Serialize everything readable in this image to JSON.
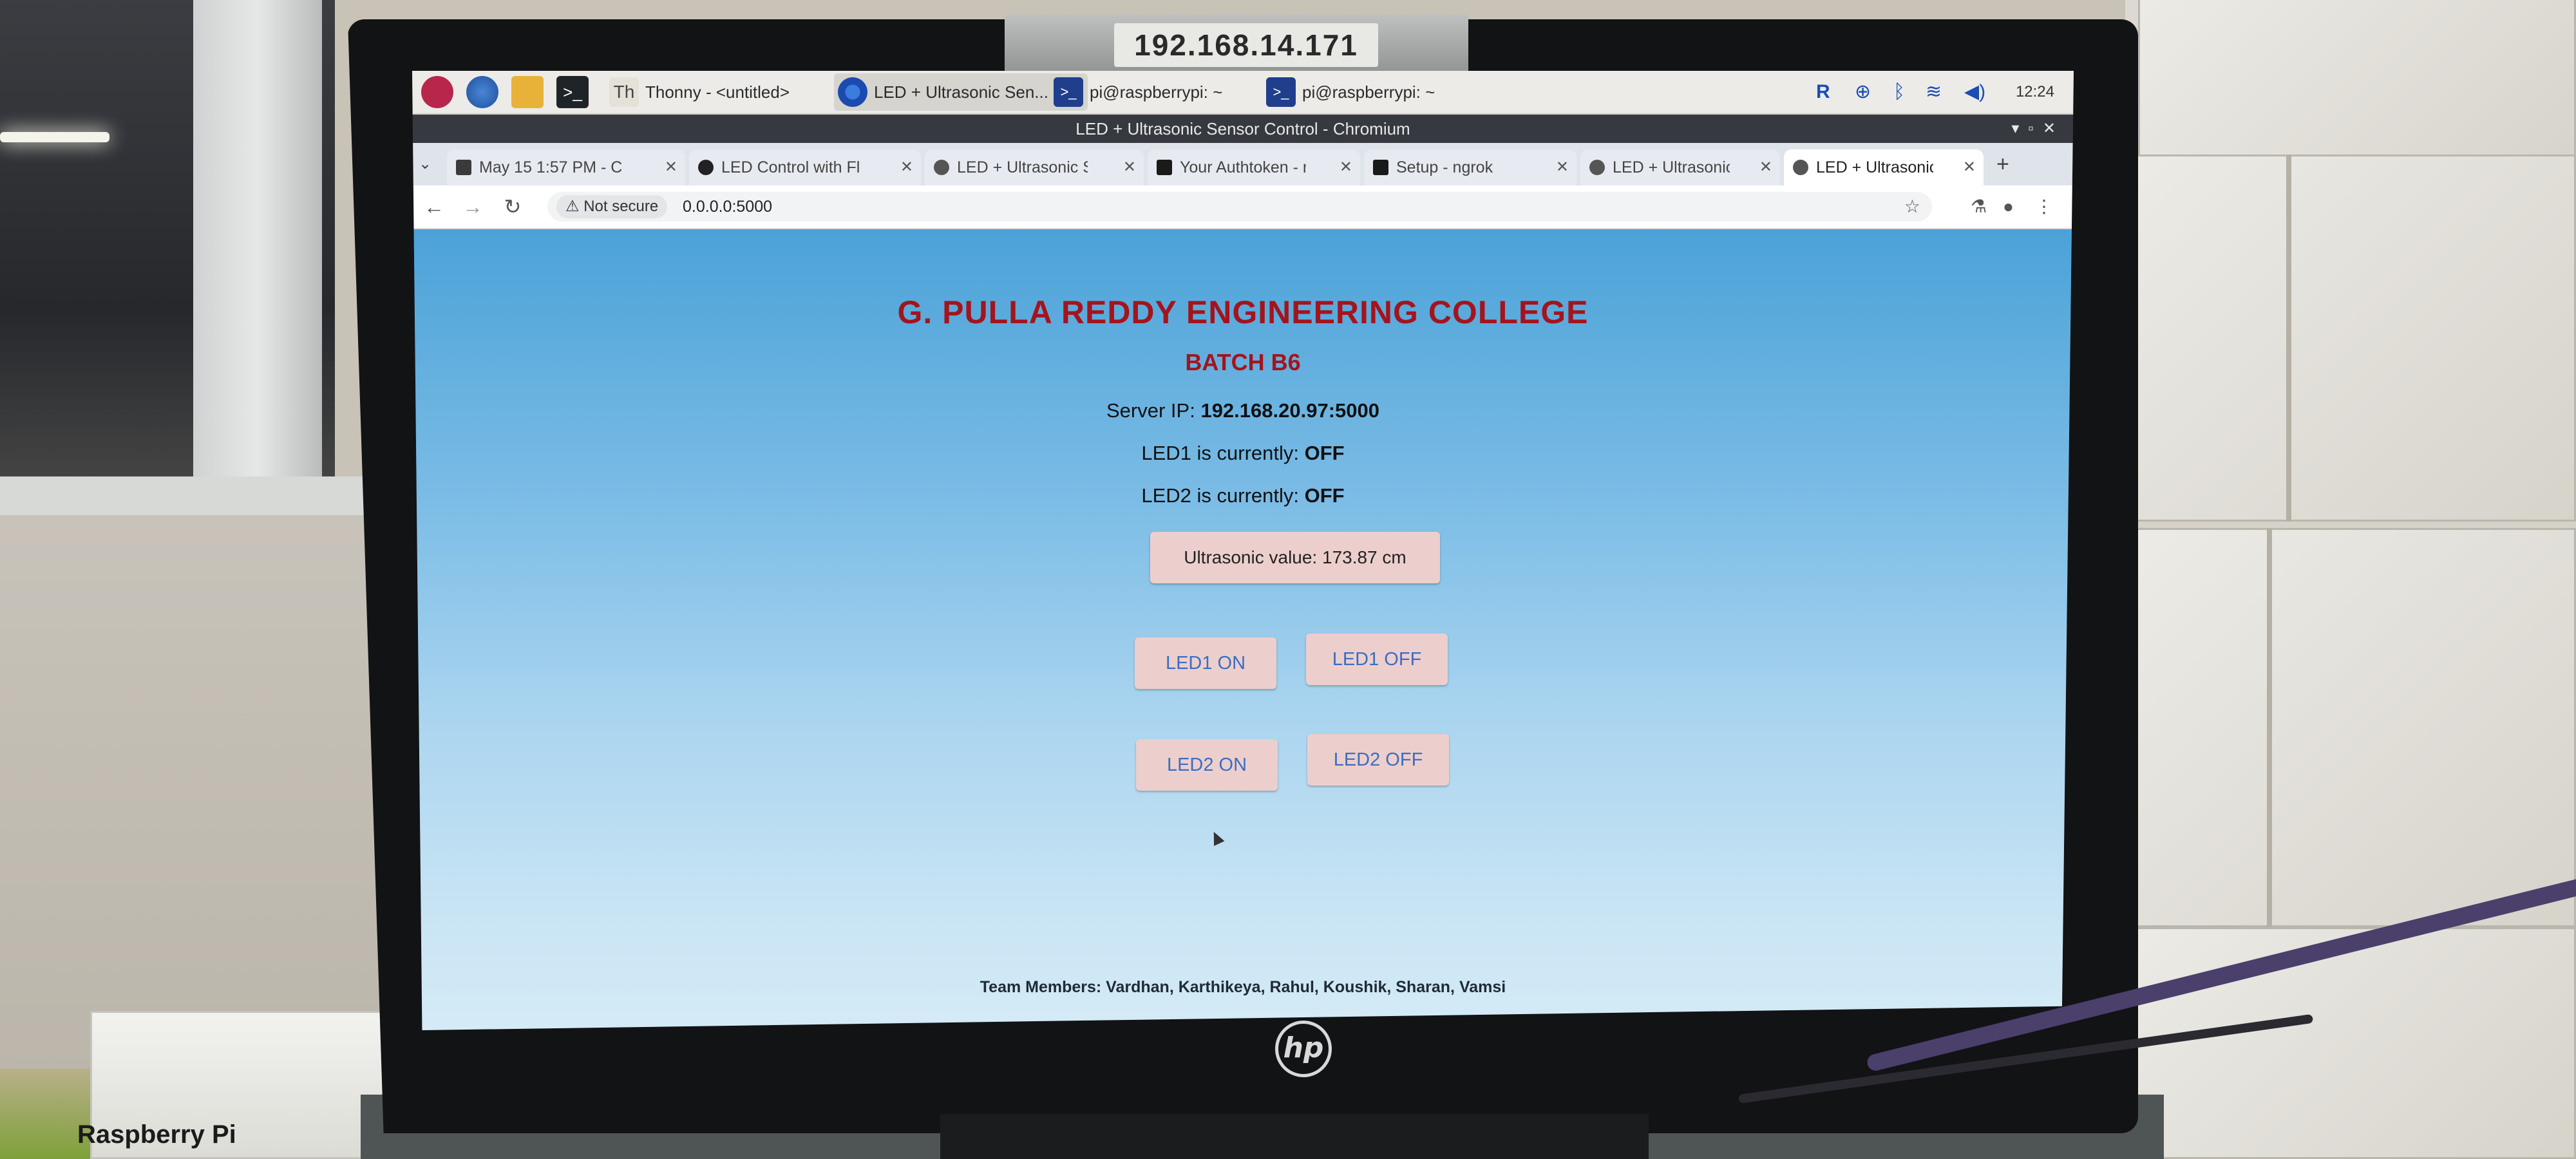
{
  "monitor": {
    "ip_sticker": "192.168.14.171",
    "brand": "hp"
  },
  "room": {
    "box_label": "Raspberry Pi"
  },
  "taskbar": {
    "tasks": [
      {
        "label": "Thonny - <untitled>",
        "icon": "thonny-icon"
      },
      {
        "label": "LED + Ultrasonic Sen...",
        "icon": "chromium-icon"
      },
      {
        "label": "pi@raspberrypi: ~",
        "icon": "terminal-icon"
      },
      {
        "label": "pi@raspberrypi: ~",
        "icon": "terminal-icon"
      }
    ],
    "clock": "12:24"
  },
  "window": {
    "title": "LED + Ultrasonic Sensor Control - Chromium"
  },
  "tabs": [
    {
      "label": "May 15 1:57 PM - C"
    },
    {
      "label": "LED Control with Fl"
    },
    {
      "label": "LED + Ultrasonic Se"
    },
    {
      "label": "Your Authtoken - n"
    },
    {
      "label": "Setup - ngrok"
    },
    {
      "label": "LED + Ultrasonic Se"
    },
    {
      "label": "LED + Ultrasonic Se"
    }
  ],
  "toolbar": {
    "security_label": "Not secure",
    "url": "0.0.0.0:5000"
  },
  "page": {
    "title": "G. PULLA REDDY ENGINEERING COLLEGE",
    "batch": "BATCH B6",
    "server_ip_label": "Server IP:",
    "server_ip": "192.168.20.97:5000",
    "led1_label": "LED1 is currently:",
    "led1_state": "OFF",
    "led2_label": "LED2 is currently:",
    "led2_state": "OFF",
    "ultrasonic_text": "Ultrasonic value: 173.87 cm",
    "buttons": {
      "led1_on": "LED1 ON",
      "led1_off": "LED1 OFF",
      "led2_on": "LED2 ON",
      "led2_off": "LED2 OFF"
    },
    "footer": "Team Members: Vardhan, Karthikeya, Rahul, Koushik, Sharan, Vamsi"
  }
}
